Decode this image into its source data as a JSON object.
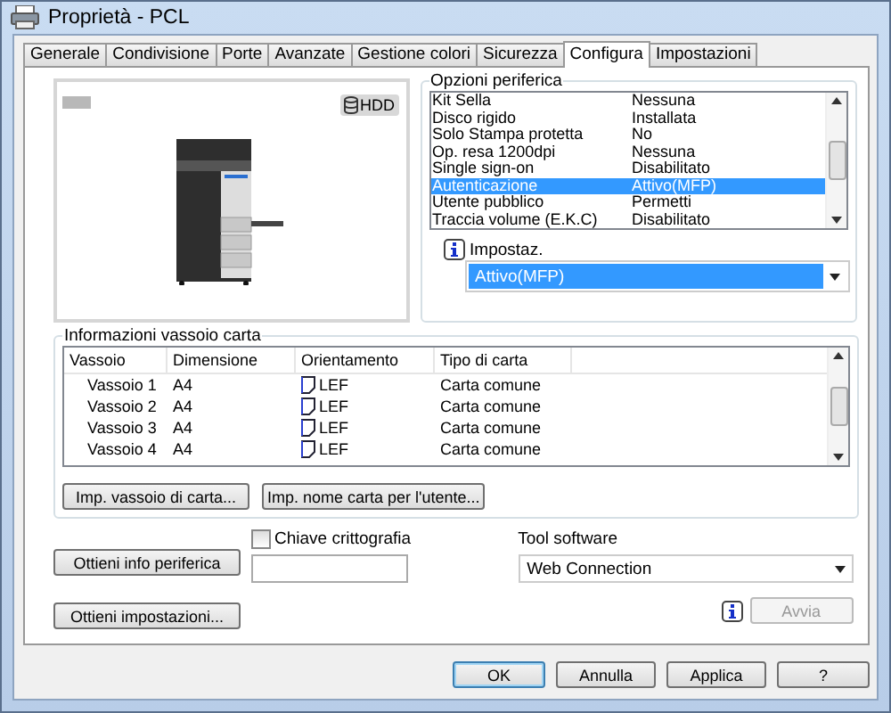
{
  "window": {
    "title": "Proprietà - PCL"
  },
  "tabs": [
    {
      "label": "Generale",
      "selected": false
    },
    {
      "label": "Condivisione",
      "selected": false
    },
    {
      "label": "Porte",
      "selected": false
    },
    {
      "label": "Avanzate",
      "selected": false
    },
    {
      "label": "Gestione colori",
      "selected": false
    },
    {
      "label": "Sicurezza",
      "selected": false
    },
    {
      "label": "Configura",
      "selected": true
    },
    {
      "label": "Impostazioni",
      "selected": false
    }
  ],
  "preview": {
    "badge": "HDD"
  },
  "device_options": {
    "title": "Opzioni periferica",
    "rows": [
      {
        "name": "Kit Sella",
        "value": "Nessuna",
        "selected": false
      },
      {
        "name": "Disco rigido",
        "value": "Installata",
        "selected": false
      },
      {
        "name": "Solo Stampa protetta",
        "value": "No",
        "selected": false
      },
      {
        "name": "Op. resa 1200dpi",
        "value": "Nessuna",
        "selected": false
      },
      {
        "name": "Single sign-on",
        "value": "Disabilitato",
        "selected": false
      },
      {
        "name": "Autenticazione",
        "value": "Attivo(MFP)",
        "selected": true
      },
      {
        "name": "Utente pubblico",
        "value": "Permetti",
        "selected": false
      },
      {
        "name": "Traccia volume (E.K.C)",
        "value": "Disabilitato",
        "selected": false
      }
    ],
    "setting_label": "Impostaz.",
    "setting_value": "Attivo(MFP)"
  },
  "tray_info": {
    "title": "Informazioni vassoio carta",
    "columns": [
      "Vassoio",
      "Dimensione",
      "Orientamento",
      "Tipo di carta"
    ],
    "rows": [
      {
        "tray": "Vassoio 1",
        "size": "A4",
        "orientation": "LEF",
        "paper_type": "Carta comune"
      },
      {
        "tray": "Vassoio 2",
        "size": "A4",
        "orientation": "LEF",
        "paper_type": "Carta comune"
      },
      {
        "tray": "Vassoio 3",
        "size": "A4",
        "orientation": "LEF",
        "paper_type": "Carta comune"
      },
      {
        "tray": "Vassoio 4",
        "size": "A4",
        "orientation": "LEF",
        "paper_type": "Carta comune"
      }
    ],
    "buttons": [
      "Imp. vassoio di carta...",
      "Imp. nome carta per l'utente..."
    ]
  },
  "get_device_info_button": "Ottieni info periferica",
  "get_settings_button": "Ottieni impostazioni...",
  "encryption_key": {
    "label": "Chiave crittografia",
    "checked": false
  },
  "tool_software": {
    "label": "Tool software",
    "value": "Web Connection"
  },
  "start_button": {
    "label": "Avvia",
    "disabled": true
  },
  "dialog_buttons": [
    {
      "label": "OK",
      "default": true
    },
    {
      "label": "Annulla",
      "default": false
    },
    {
      "label": "Applica",
      "default": false
    },
    {
      "label": "?",
      "default": false
    }
  ]
}
